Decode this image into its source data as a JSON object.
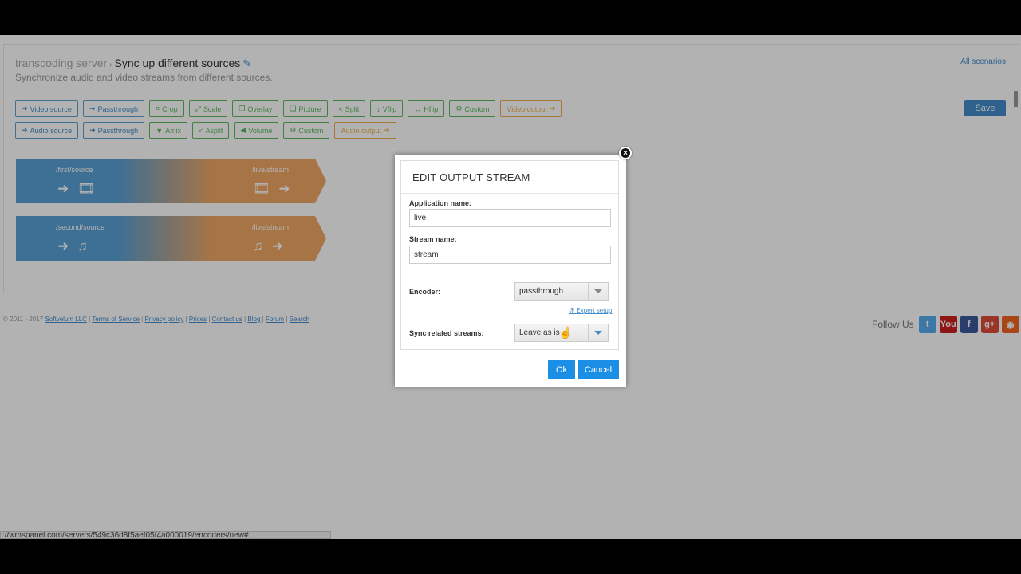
{
  "header": {
    "breadcrumb_root": "transcoding server",
    "separator": "›",
    "title": "Sync up different sources",
    "subtitle": "Synchronize audio and video streams from different sources.",
    "all_scenarios": "All scenarios",
    "save": "Save"
  },
  "toolbar": {
    "row1": [
      {
        "label": "Video source",
        "icon": "login-icon",
        "glyph": "➜",
        "color": "blue"
      },
      {
        "label": "Passthrough",
        "icon": "login-icon",
        "glyph": "➜",
        "color": "blue"
      },
      {
        "label": "Crop",
        "icon": "crop-icon",
        "glyph": "⌗",
        "color": "green"
      },
      {
        "label": "Scale",
        "icon": "resize-icon",
        "glyph": "⤢",
        "color": "green"
      },
      {
        "label": "Overlay",
        "icon": "overlay-icon",
        "glyph": "❐",
        "color": "green"
      },
      {
        "label": "Picture",
        "icon": "picture-icon",
        "glyph": "❏",
        "color": "green"
      },
      {
        "label": "Split",
        "icon": "share-icon",
        "glyph": "<",
        "color": "green"
      },
      {
        "label": "Vflip",
        "icon": "vertical-flip-icon",
        "glyph": "↕",
        "color": "green"
      },
      {
        "label": "Hflip",
        "icon": "horizontal-flip-icon",
        "glyph": "↔",
        "color": "green"
      },
      {
        "label": "Custom",
        "icon": "cogs-icon",
        "glyph": "⚙",
        "color": "green"
      },
      {
        "label": "Video output",
        "icon": "logout-icon",
        "glyph": "➜",
        "color": "orange"
      }
    ],
    "row2": [
      {
        "label": "Audio source",
        "icon": "login-icon",
        "glyph": "➜",
        "color": "blue"
      },
      {
        "label": "Passthrough",
        "icon": "login-icon",
        "glyph": "➜",
        "color": "blue"
      },
      {
        "label": "Amix",
        "icon": "filter-icon",
        "glyph": "▼",
        "color": "green"
      },
      {
        "label": "Asplit",
        "icon": "share-icon",
        "glyph": "<",
        "color": "green"
      },
      {
        "label": "Volume",
        "icon": "volume-icon",
        "glyph": "◀",
        "color": "green"
      },
      {
        "label": "Custom",
        "icon": "cogs-icon",
        "glyph": "⚙",
        "color": "green"
      },
      {
        "label": "Audio output",
        "icon": "logout-icon",
        "glyph": "➜",
        "color": "orange"
      }
    ]
  },
  "pipelines": [
    {
      "source": "/first/source",
      "output": "/live/stream",
      "source_icons": "➜ 🎞",
      "output_icons": "🎞 ➜",
      "kind": "video"
    },
    {
      "source": "/second/source",
      "output": "/live/stream",
      "source_icons": "➜ ♫",
      "output_icons": "♫ ➜",
      "kind": "audio"
    }
  ],
  "footer": {
    "copyright": "© 2011 - 2017",
    "links": [
      "Softvelum LLC",
      "Terms of Service",
      "Privacy policy",
      "Prices",
      "Contact us",
      "Blog",
      "Forum",
      "Search"
    ],
    "follow_us": "Follow Us",
    "social": [
      {
        "name": "twitter-icon",
        "glyph": "t",
        "color": "#55acee"
      },
      {
        "name": "youtube-icon",
        "glyph": "You",
        "color": "#cd201f"
      },
      {
        "name": "facebook-icon",
        "glyph": "f",
        "color": "#3b5998"
      },
      {
        "name": "googleplus-icon",
        "glyph": "g+",
        "color": "#dd4b39"
      },
      {
        "name": "rss-icon",
        "glyph": "◉",
        "color": "#f26522"
      }
    ]
  },
  "status_url": "://wmspanel.com/servers/549c36d8f5aef05f4a000019/encoders/new#",
  "modal": {
    "title": "EDIT OUTPUT STREAM",
    "app_label": "Application name:",
    "app_value": "live",
    "stream_label": "Stream name:",
    "stream_value": "stream",
    "encoder_label": "Encoder:",
    "encoder_value": "passthrough",
    "expert_setup": "Expert setup",
    "sync_label": "Sync related streams:",
    "sync_value": "Leave as is",
    "ok": "Ok",
    "cancel": "Cancel",
    "close": "×"
  }
}
